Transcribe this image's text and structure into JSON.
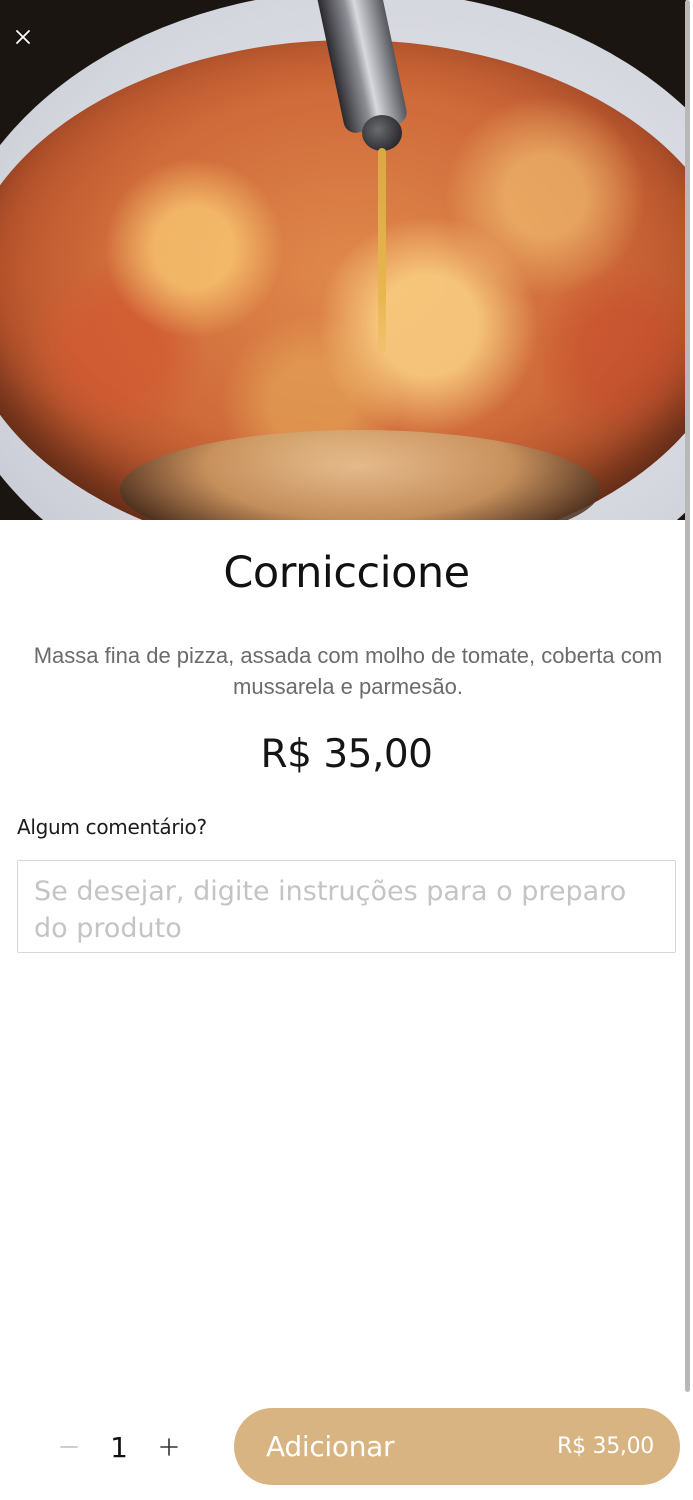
{
  "header": {
    "close_icon": "close-icon"
  },
  "product": {
    "name": "Corniccione",
    "description": "Massa fina de pizza, assada com molho de tomate, coberta com mussarela e parmesão.",
    "price": "R$ 35,00"
  },
  "comment": {
    "label": "Algum comentário?",
    "placeholder": "Se desejar, digite instruções para o preparo do produto",
    "value": ""
  },
  "footer": {
    "quantity": "1",
    "minus_icon": "minus-icon",
    "plus_icon": "plus-icon",
    "add_label": "Adicionar",
    "add_total": "R$ 35,00"
  },
  "colors": {
    "accent": "#d8b482",
    "description_text": "#6b6b6b",
    "placeholder_text": "#c4c4c4"
  }
}
